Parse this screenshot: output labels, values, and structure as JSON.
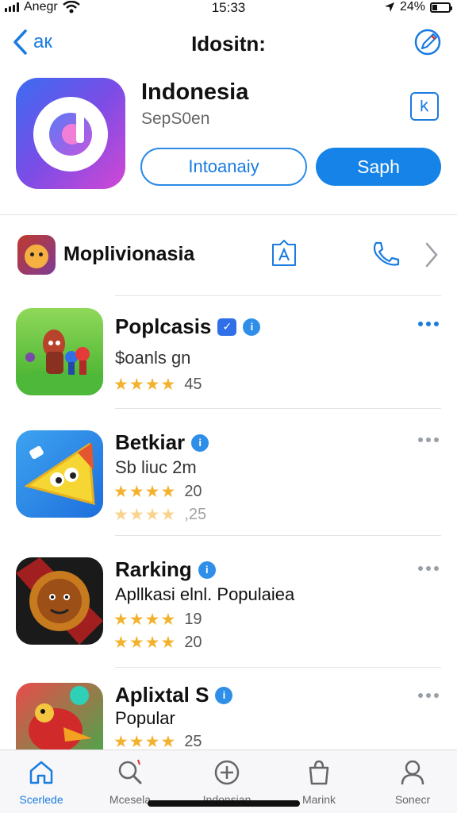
{
  "status": {
    "carrier": "Anegr",
    "time": "15:33",
    "battery": "24%"
  },
  "nav": {
    "back_label": "ак",
    "title": "Idositn:"
  },
  "app": {
    "name": "Indonesia",
    "subtitle": "SepS0en",
    "button_outline": "Intoanaiy",
    "button_primary": "Saph"
  },
  "developer": {
    "name": "Moplivionasia"
  },
  "list": [
    {
      "title": "Poplcasis",
      "subtitle": "$oanls gn",
      "ratings": [
        {
          "stars": "★★★★",
          "value": "45"
        }
      ]
    },
    {
      "title": "Betkiar",
      "subtitle": "Sb liuc 2m",
      "ratings": [
        {
          "stars": "★★★★",
          "value": "20"
        },
        {
          "stars": "★★★★",
          "value": ",25"
        }
      ]
    },
    {
      "title": "Rarking",
      "subtitle": "Apllkasi elnl. Populaiea",
      "ratings": [
        {
          "stars": "★★★★",
          "value": "19"
        },
        {
          "stars": "★★★★",
          "value": "20"
        }
      ]
    },
    {
      "title": "Aplixtal S",
      "subtitle": "Popular",
      "ratings": [
        {
          "stars": "★★★★",
          "value": "25"
        }
      ]
    }
  ],
  "tabs": [
    {
      "label": "Scerlede"
    },
    {
      "label": "Mcesela"
    },
    {
      "label": "Indonsian"
    },
    {
      "label": "Marink"
    },
    {
      "label": "Sonecr"
    }
  ],
  "colors": {
    "accent": "#1a7be0",
    "star": "#f3b22e"
  },
  "icons": [
    "signal-icon",
    "wifi-icon",
    "location-icon",
    "battery-icon",
    "chevron-left-icon",
    "edit-icon",
    "bookmark-icon",
    "contact-icon",
    "phone-icon",
    "chevron-right-icon",
    "more-icon",
    "home-icon",
    "search-icon",
    "add-icon",
    "bag-icon",
    "person-icon"
  ]
}
